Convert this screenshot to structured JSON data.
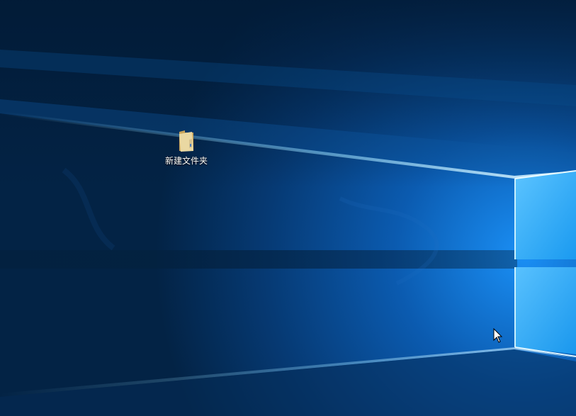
{
  "desktop": {
    "icons": [
      {
        "label": "新建文件夹",
        "icon": "folder-icon"
      }
    ]
  },
  "wallpaper": {
    "theme": "windows-10-hero",
    "colors": {
      "dark": "#021d3b",
      "mid": "#0a4d8f",
      "bright": "#1b8bf0",
      "glow": "#7fd3ff",
      "folder": "#e8d39b"
    }
  },
  "cursor": {
    "icon": "arrow-cursor-icon"
  }
}
